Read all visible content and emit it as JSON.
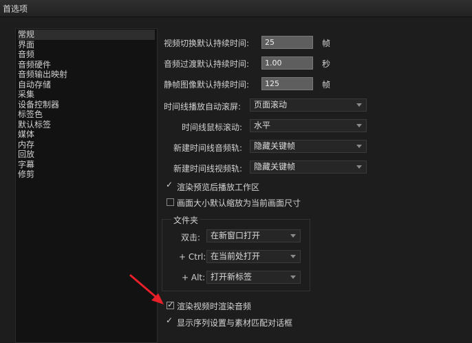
{
  "window": {
    "title": "首选项"
  },
  "sidebar": {
    "items": [
      "常规",
      "界面",
      "音频",
      "音频硬件",
      "音频输出映射",
      "自动存储",
      "采集",
      "设备控制器",
      "标签色",
      "默认标签",
      "媒体",
      "内存",
      "回放",
      "字幕",
      "修剪"
    ]
  },
  "settings": {
    "video_transition": {
      "label": "视频切换默认持续时间:",
      "value": "25",
      "unit": "帧"
    },
    "audio_transition": {
      "label": "音频过渡默认持续时间:",
      "value": "1.00",
      "unit": "秒"
    },
    "still_image": {
      "label": "静帧图像默认持续时间:",
      "value": "125",
      "unit": "帧"
    },
    "timeline_autoscroll": {
      "label": "时间线播放自动滚屏:",
      "value": "页面滚动"
    },
    "timeline_mouse_scroll": {
      "label": "时间线鼠标滚动:",
      "value": "水平"
    },
    "new_audio_track": {
      "label": "新建时间线音频轨:",
      "value": "隐藏关键帧"
    },
    "new_video_track": {
      "label": "新建时间线视频轨:",
      "value": "隐藏关键帧"
    },
    "play_after_render": {
      "label": "渲染预览后播放工作区",
      "checked": true
    },
    "scale_to_frame": {
      "label": "画面大小默认缩放为当前画面尺寸",
      "checked": false
    },
    "bin": {
      "title": "文件夹",
      "double_click": {
        "label": "双击:",
        "value": "在新窗口打开"
      },
      "ctrl": {
        "label": "+ Ctrl:",
        "value": "在当前处打开"
      },
      "alt": {
        "label": "+ Alt:",
        "value": "打开新标签"
      }
    },
    "render_audio": {
      "label": "渲染视频时渲染音频",
      "checked": true
    },
    "sequence_dialog": {
      "label": "显示序列设置与素材匹配对话框",
      "checked": true
    }
  },
  "colors": {
    "annotation_arrow": "#e8202a"
  }
}
